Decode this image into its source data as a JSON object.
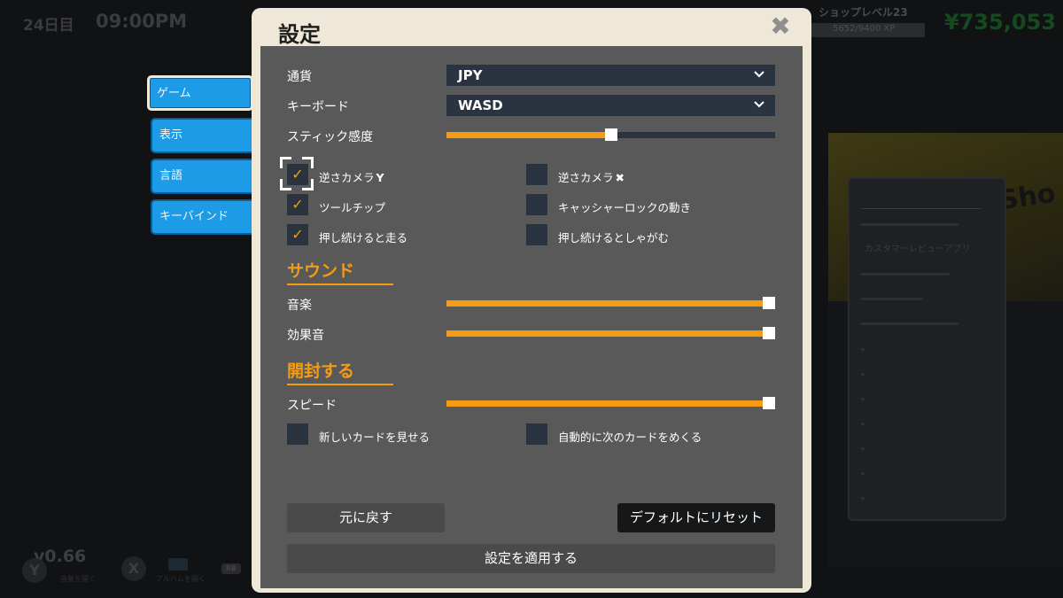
{
  "hud": {
    "day": "24日目",
    "time": "09:00PM",
    "shop_level": "ショップレベル23",
    "xp": "5652/9400 XP",
    "money": "¥735,053",
    "sign": "Sho",
    "app_label": "カスタマーレビューアプリ"
  },
  "footer": {
    "version": "v0.66",
    "btn_y": "Y",
    "btn_x": "X",
    "hint1": "音量を開く",
    "hint2": "アルバムを開く",
    "btn_rb": "RB"
  },
  "tabs": [
    {
      "label": "ゲーム",
      "active": true
    },
    {
      "label": "表示"
    },
    {
      "label": "言語"
    },
    {
      "label": "キーバインド"
    }
  ],
  "modal": {
    "title": "設定",
    "close_icon": "close-icon"
  },
  "settings": {
    "currency": {
      "label": "通貨",
      "value": "JPY"
    },
    "keyboard": {
      "label": "キーボード",
      "value": "WASD"
    },
    "stick": {
      "label": "スティック感度",
      "value": 0.5
    },
    "checks": [
      {
        "label": "逆さカメラ",
        "glyph": "Y",
        "checked": true,
        "focused": true
      },
      {
        "label": "逆さカメラ",
        "glyph": "✖",
        "checked": false
      },
      {
        "label": "ツールチップ",
        "checked": true
      },
      {
        "label": "キャッシャーロックの動き",
        "checked": false
      },
      {
        "label": "押し続けると走る",
        "checked": true
      },
      {
        "label": "押し続けるとしゃがむ",
        "checked": false
      }
    ]
  },
  "sound": {
    "title": "サウンド",
    "music": {
      "label": "音楽",
      "value": 1.0
    },
    "sfx": {
      "label": "効果音",
      "value": 1.0
    }
  },
  "open": {
    "title": "開封する",
    "speed": {
      "label": "スピード",
      "value": 1.0
    },
    "checks": [
      {
        "label": "新しいカードを見せる",
        "checked": false
      },
      {
        "label": "自動的に次のカードをめくる",
        "checked": false
      }
    ]
  },
  "buttons": {
    "revert": "元に戻す",
    "reset": "デフォルトにリセット",
    "apply": "設定を適用する"
  },
  "colors": {
    "accent": "#f59c14",
    "tab": "#1d9be6",
    "panel": "#595959",
    "control": "#2a3441",
    "modal_bg": "#efe8d8"
  }
}
